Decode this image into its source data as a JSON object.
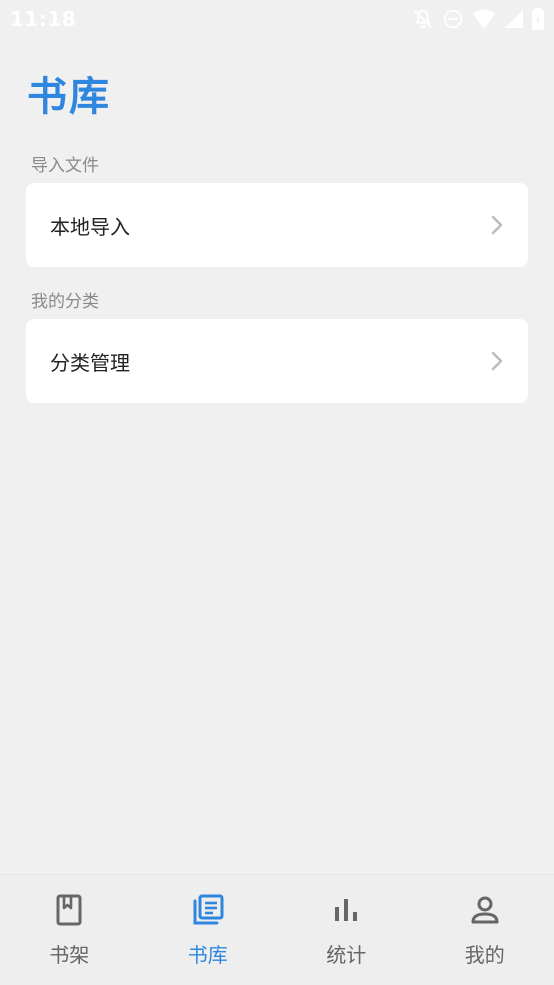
{
  "status_bar": {
    "time": "11:18"
  },
  "page": {
    "title": "书库"
  },
  "sections": [
    {
      "label": "导入文件",
      "item": "本地导入"
    },
    {
      "label": "我的分类",
      "item": "分类管理"
    }
  ],
  "nav": {
    "items": [
      {
        "label": "书架",
        "icon": "bookmark-book-icon",
        "active": false
      },
      {
        "label": "书库",
        "icon": "library-icon",
        "active": true
      },
      {
        "label": "统计",
        "icon": "bar-chart-icon",
        "active": false
      },
      {
        "label": "我的",
        "icon": "person-icon",
        "active": false
      }
    ]
  },
  "colors": {
    "accent": "#2f86de",
    "background": "#f0f0f0",
    "card": "#ffffff",
    "inactive": "#666666"
  }
}
